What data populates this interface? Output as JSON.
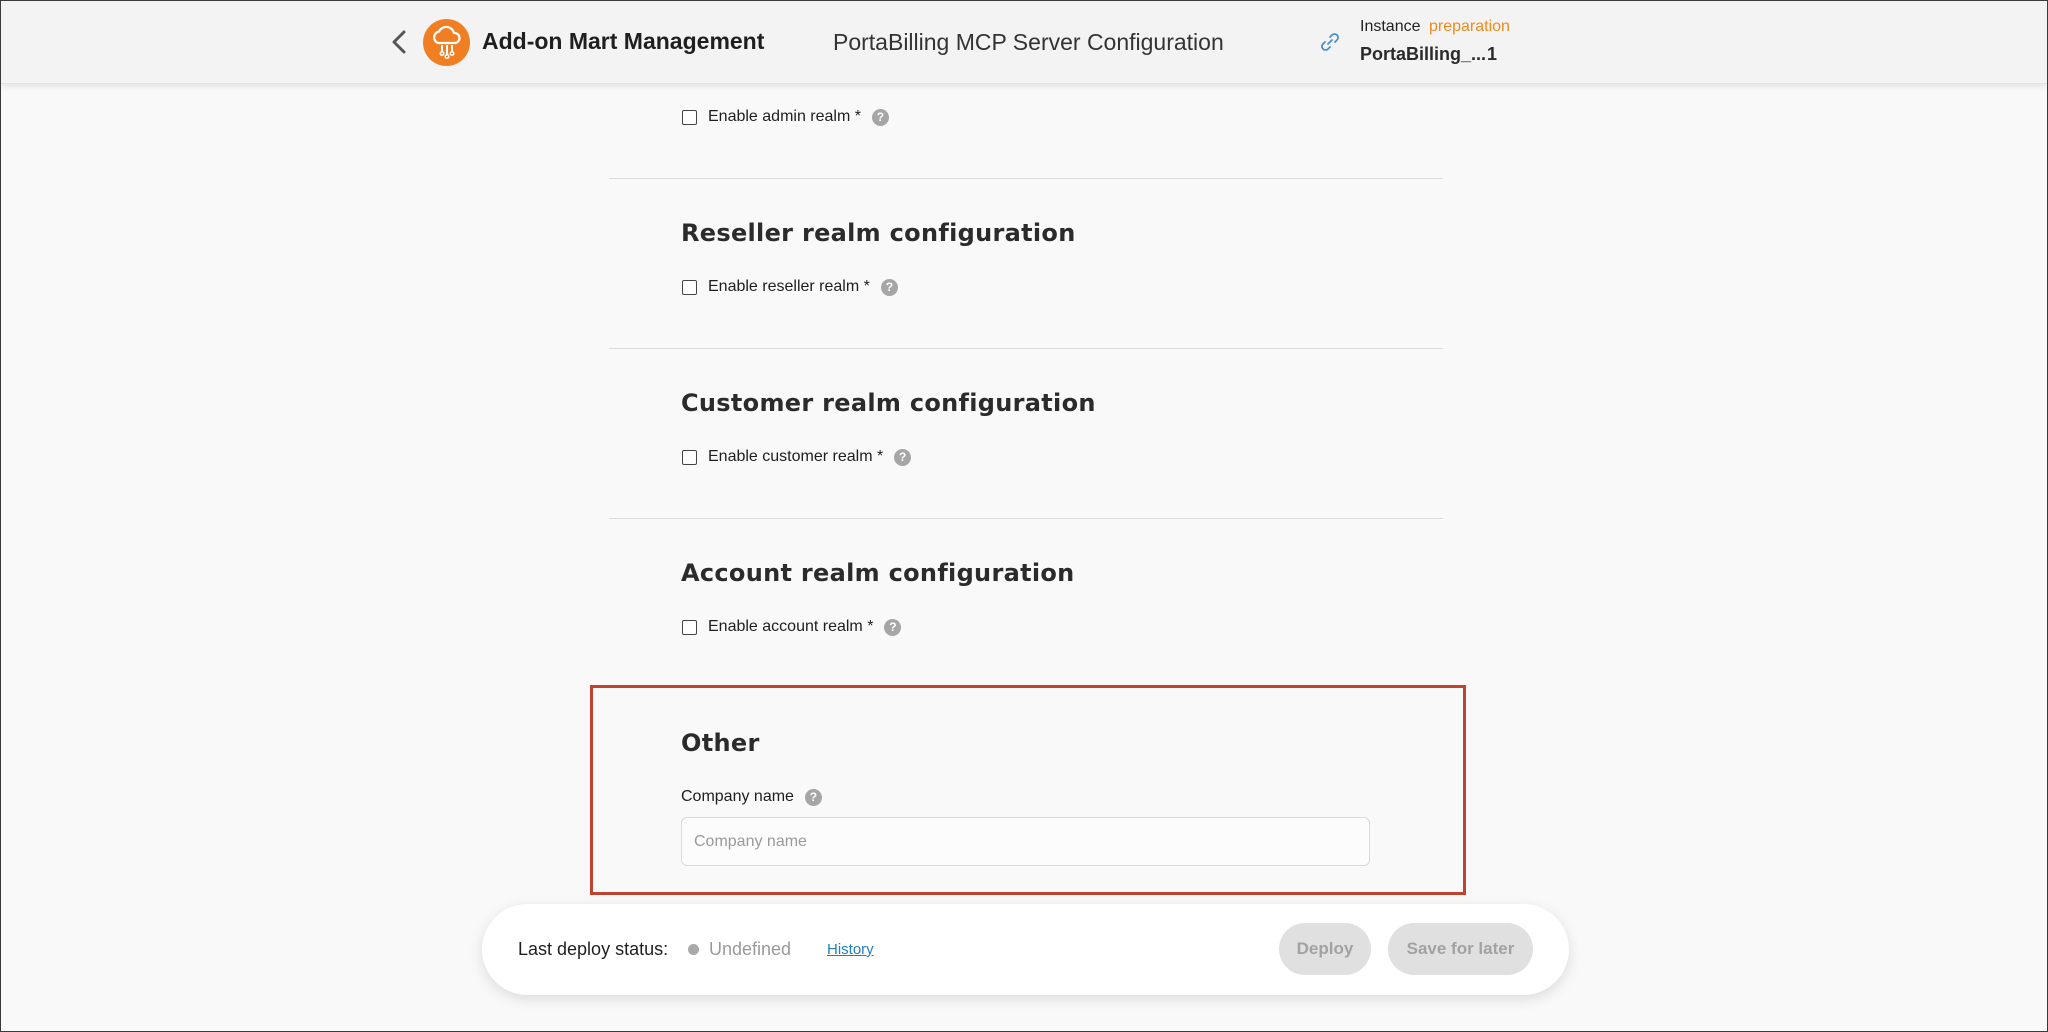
{
  "header": {
    "app_title": "Add-on Mart Management",
    "page_title": "PortaBilling MCP Server Configuration",
    "instance_label": "Instance",
    "instance_status": "preparation",
    "instance_name": "PortaBilling_...",
    "instance_number": "1",
    "logo_color": "#f07f23"
  },
  "sections": {
    "admin": {
      "checkbox_label": "Enable admin realm *",
      "checked": false
    },
    "reseller": {
      "heading": "Reseller realm configuration",
      "checkbox_label": "Enable reseller realm *",
      "checked": false
    },
    "customer": {
      "heading": "Customer realm configuration",
      "checkbox_label": "Enable customer realm *",
      "checked": false
    },
    "account": {
      "heading": "Account realm configuration",
      "checkbox_label": "Enable account realm *",
      "checked": false
    },
    "other": {
      "heading": "Other",
      "company_name_label": "Company name",
      "company_name_placeholder": "Company name",
      "company_name_value": "",
      "highlight_color": "#c0432f"
    }
  },
  "footer": {
    "deploy_status_label": "Last deploy status:",
    "deploy_status_value": "Undefined",
    "history_link": "History",
    "deploy_button": "Deploy",
    "save_button": "Save for later"
  }
}
